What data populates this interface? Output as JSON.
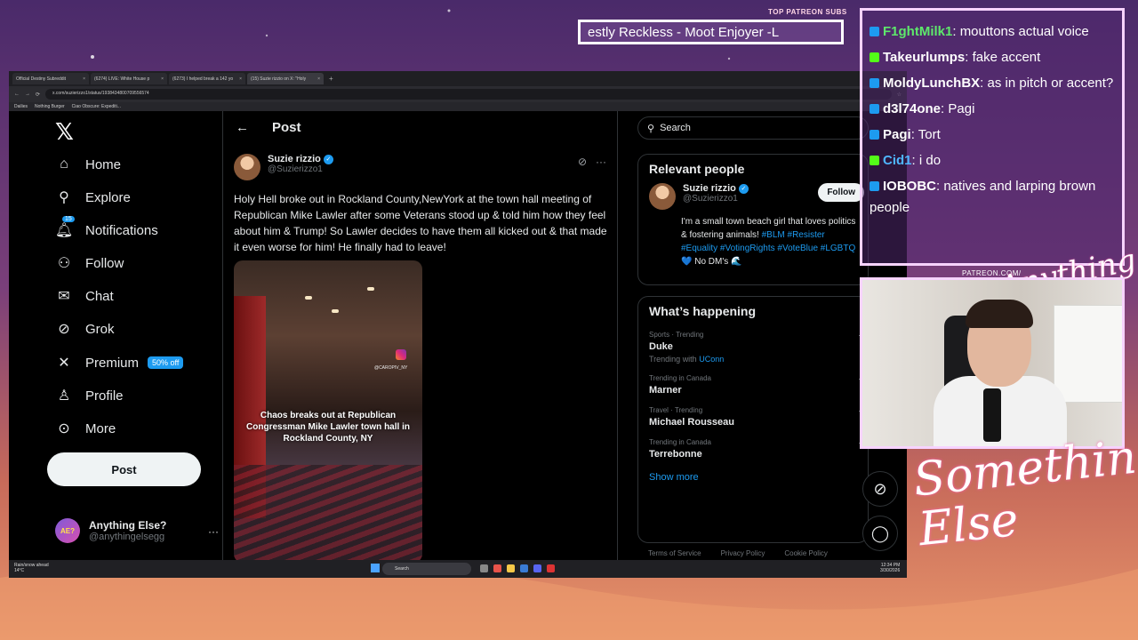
{
  "overlay": {
    "patreon_label": "TOP PATREON SUBS",
    "ticker_text": "estly Reckless - Moot Enjoyer -L",
    "patreon_url": "PATREON.COM/",
    "logo_small": "Anything Else?",
    "logo_big": "Something Else",
    "chat": [
      {
        "user": "F1ghtMilk1",
        "message": "mouttons actual voice",
        "icon_color": "#1d9bf0",
        "user_color": "#5ee86b"
      },
      {
        "user": "Takeurlumps",
        "message": "fake accent",
        "icon_color": "#53fc18",
        "user_color": "#ffffff"
      },
      {
        "user": "MoldyLunchBX",
        "message": "as in pitch or accent?",
        "icon_color": "#1d9bf0",
        "user_color": "#ffffff"
      },
      {
        "user": "d3l74one",
        "message": "Pagi",
        "icon_color": "#1d9bf0",
        "user_color": "#ffffff"
      },
      {
        "user": "Pagi",
        "message": "Tort",
        "icon_color": "#1d9bf0",
        "user_color": "#ffffff"
      },
      {
        "user": "Cid1",
        "message": "i do",
        "icon_color": "#53fc18",
        "user_color": "#4fb6ff"
      },
      {
        "user": "IOBOBC",
        "message": "natives and larping brown people",
        "icon_color": "#1d9bf0",
        "user_color": "#ffffff"
      }
    ]
  },
  "browser": {
    "tabs": [
      "Official Destiny Subreddit",
      "(6274) LIVE: White House p",
      "(6273) I helped break a 142 yo",
      "(15) Suzie rizzio on X: \"Holy"
    ],
    "url": "x.com/suzierizzo1/status/1938434800709556574",
    "bookmarks": [
      "Dailies",
      "Nothing Burger",
      "Ciao Obscure: Expediti..."
    ]
  },
  "nav": {
    "items": [
      {
        "label": "Home",
        "icon": "home-icon"
      },
      {
        "label": "Explore",
        "icon": "search-icon"
      },
      {
        "label": "Notifications",
        "icon": "bell-icon",
        "badge": "15"
      },
      {
        "label": "Follow",
        "icon": "add-user-icon"
      },
      {
        "label": "Chat",
        "icon": "mail-icon"
      },
      {
        "label": "Grok",
        "icon": "grok-icon"
      },
      {
        "label": "Premium",
        "icon": "x-icon",
        "pill": "50% off"
      },
      {
        "label": "Profile",
        "icon": "person-icon"
      },
      {
        "label": "More",
        "icon": "more-circle-icon"
      }
    ],
    "post_button": "Post",
    "account": {
      "name": "Anything Else?",
      "handle": "@anythingelsegg",
      "avatar_text": "AE?"
    }
  },
  "post": {
    "header": "Post",
    "author_name": "Suzie rizzio",
    "author_handle": "@Suzierizzo1",
    "text": "Holy Hell broke out in Rockland County,NewYork at the town hall meeting of Republican Mike Lawler after some Veterans stood up & told him how they feel about him & Trump! So Lawler decides to have them all kicked out & that made it even worse for him! He finally had to leave!",
    "media_caption": "Chaos breaks out at Republican Congressman Mike Lawler town hall in Rockland County, NY",
    "media_tag": "@CAROPIV_NY"
  },
  "right": {
    "search_placeholder": "Search",
    "relevant_title": "Relevant people",
    "person": {
      "name": "Suzie rizzio",
      "handle": "@Suzierizzo1",
      "follow_label": "Follow",
      "bio_text": "I'm a small town beach girl that loves politics & fostering animals! ",
      "bio_tags": "#BLM #Resister #Equality #VotingRights #VoteBlue #LGBTQ",
      "bio_end": " 💙 No DM's 🌊"
    },
    "happening_title": "What’s happening",
    "trends": [
      {
        "meta": "Sports · Trending",
        "name": "Duke",
        "with_label": "Trending with",
        "with_tag": "UConn"
      },
      {
        "meta": "Trending in Canada",
        "name": "Marner"
      },
      {
        "meta": "Travel · Trending",
        "name": "Michael Rousseau"
      },
      {
        "meta": "Trending in Canada",
        "name": "Terrebonne"
      }
    ],
    "show_more": "Show more",
    "footer": [
      "Terms of Service",
      "Privacy Policy",
      "Cookie Policy"
    ]
  },
  "taskbar": {
    "weather": "Rain/snow ahead",
    "temp": "14°C",
    "search": "Search",
    "time": "12:34 PM",
    "date": "3/30/2026"
  }
}
